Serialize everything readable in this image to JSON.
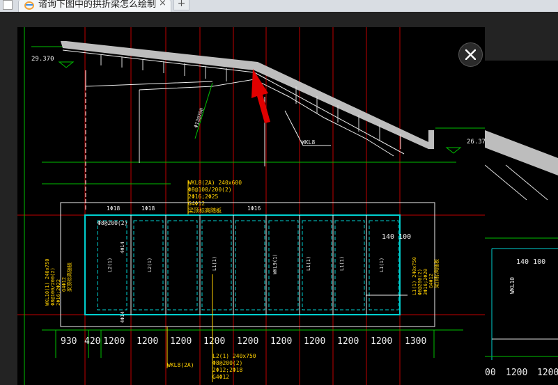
{
  "browser": {
    "tab_title": "谘询下图中的拱折梁怎么绘制",
    "tab_close": "×",
    "new_tab": "+"
  },
  "drawing": {
    "elev_left": "29.370",
    "elev_right": "26.370",
    "beam_label_slope": "WKL8",
    "rebar_label": "Φ12@200",
    "main_beam": [
      "WKL8(2A) 240x600",
      "Φ8@100/200(2)",
      "2Φ16;2Φ25",
      "G4Φ12",
      "梁顶标高随板"
    ],
    "top_left_marks": [
      "1Φ18",
      "1Φ18",
      "1Φ16"
    ],
    "slab_mark": "Φ8@200(2)",
    "left_beam": [
      "WKL10(1) 240x750",
      "Φ8@100/200(2)",
      "2Φ16;2Φ22",
      "G4Φ12",
      "梁顶标高随板"
    ],
    "right_beam": [
      "L1(1) 240x750",
      "Φ8@200(2)",
      "3Φ16;2Φ20",
      "G4Φ12",
      "梁顶标高随板"
    ],
    "l_labels": [
      "L2(1)",
      "L2(1)",
      "L1(1)",
      "WKL9(1)",
      "L1(1)",
      "L1(1)",
      "L1(1)"
    ],
    "spacing_label": "140 100",
    "bottom_beam": [
      "L2(1) 240x750",
      "Φ8@200(2)",
      "2Φ12;2Φ18",
      "G4Φ12"
    ],
    "bottom_left_label": "WKL8(2A)",
    "dimensions": [
      "930",
      "420",
      "1200",
      "1200",
      "1200",
      "1200",
      "1200",
      "1200",
      "1200",
      "1200",
      "1200",
      "1300"
    ],
    "right_partial_dims": [
      "00",
      "1200",
      "1200"
    ],
    "right_partial_label": "140 100",
    "side_marks": [
      "4Φ14",
      "4Φ14"
    ]
  }
}
